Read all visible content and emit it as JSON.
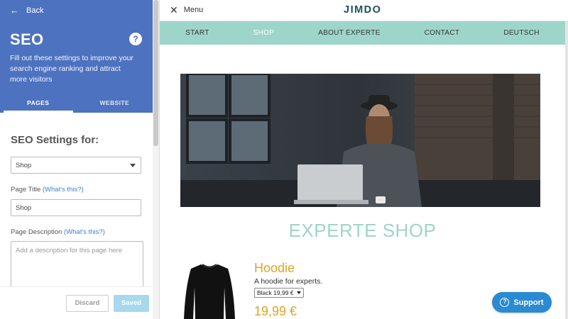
{
  "sidebar": {
    "back_label": "Back",
    "title": "SEO",
    "help_icon": "?",
    "description": "Fill out these settings to improve your search engine ranking and attract more visitors",
    "tabs": [
      {
        "label": "PAGES",
        "active": true
      },
      {
        "label": "WEBSITE",
        "active": false
      }
    ],
    "settings_heading": "SEO Settings for:",
    "page_select_value": "Shop",
    "page_title_label": "Page Title",
    "whats_this_1": "(What's this?)",
    "page_title_value": "Shop",
    "page_desc_label": "Page Description",
    "whats_this_2": "(What's this?)",
    "page_desc_placeholder": "Add a description for this page here",
    "discard_label": "Discard",
    "saved_label": "Saved"
  },
  "preview": {
    "menu_label": "Menu",
    "logo": "JIMDO",
    "nav": [
      {
        "label": "START",
        "active": false
      },
      {
        "label": "SHOP",
        "active": true
      },
      {
        "label": "ABOUT EXPERTE",
        "active": false
      },
      {
        "label": "CONTACT",
        "active": false
      },
      {
        "label": "DEUTSCH",
        "active": false
      }
    ],
    "shop_title": "EXPERTE SHOP",
    "product": {
      "name": "Hoodie",
      "description": "A hoodie for experts.",
      "variant": "Black 19,99 €",
      "price": "19,99 €"
    },
    "support_label": "Support"
  },
  "colors": {
    "sidebar_header": "#4d72c0",
    "accent_teal": "#9ed5ca",
    "price_orange": "#e0a422",
    "support_blue": "#2a8ad2",
    "saved_button": "#a8d8ee"
  }
}
